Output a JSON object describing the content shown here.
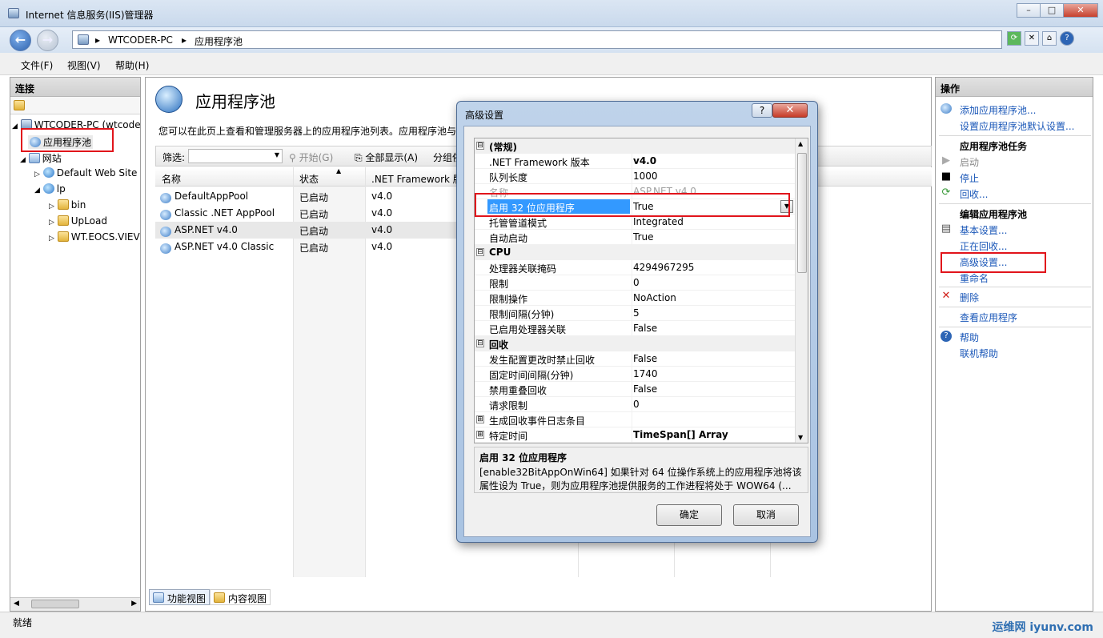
{
  "window": {
    "title": "Internet 信息服务(IIS)管理器",
    "address": [
      "WTCODER-PC",
      "应用程序池"
    ],
    "min": "–",
    "max": "□",
    "close": "✕"
  },
  "menu": [
    "文件(F)",
    "视图(V)",
    "帮助(H)"
  ],
  "left": {
    "header": "连接",
    "tree": [
      {
        "label": "WTCODER-PC (wtcoder",
        "icon": "server-icon"
      },
      {
        "label": "应用程序池",
        "icon": "app-pool-icon"
      },
      {
        "label": "网站",
        "icon": "sites-icon"
      },
      {
        "label": "Default Web Site",
        "icon": "globe-icon"
      },
      {
        "label": "lp",
        "icon": "globe-icon"
      },
      {
        "label": "bin",
        "icon": "folder-icon"
      },
      {
        "label": "UpLoad",
        "icon": "folder-icon"
      },
      {
        "label": "WT.EOCS.VIEV",
        "icon": "folder-icon"
      }
    ]
  },
  "center": {
    "title": "应用程序池",
    "description": "您可以在此页上查看和管理服务器上的应用程序池列表。应用程序池与",
    "filter_label": "筛选:",
    "start_label": "开始(G)",
    "show_all_label": "全部显示(A)",
    "group_label": "分组依",
    "columns": [
      "名称",
      "状态",
      ".NET Framework 版"
    ],
    "rows": [
      {
        "name": "DefaultAppPool",
        "status": "已启动",
        "fw": "v4.0"
      },
      {
        "name": "Classic .NET AppPool",
        "status": "已启动",
        "fw": "v4.0"
      },
      {
        "name": "ASP.NET v4.0",
        "status": "已启动",
        "fw": "v4.0"
      },
      {
        "name": "ASP.NET v4.0 Classic",
        "status": "已启动",
        "fw": "v4.0"
      }
    ],
    "tabs": [
      "功能视图",
      "内容视图"
    ]
  },
  "right": {
    "header": "操作",
    "add_pool": "添加应用程序池...",
    "set_defaults": "设置应用程序池默认设置...",
    "tasks_header": "应用程序池任务",
    "start": "启动",
    "stop": "停止",
    "recycle": "回收...",
    "edit_header": "编辑应用程序池",
    "basic": "基本设置...",
    "recycling": "正在回收...",
    "advanced": "高级设置...",
    "rename": "重命名",
    "delete": "删除",
    "view_apps": "查看应用程序",
    "help": "帮助",
    "online_help": "联机帮助"
  },
  "status": "就绪",
  "dialog": {
    "title": "高级设置",
    "help_btn": "?",
    "close_btn": "✕",
    "props": [
      {
        "cat": true,
        "exp": "⊟",
        "k": "(常规)"
      },
      {
        "k": ".NET Framework 版本",
        "v": "v4.0",
        "bold": true
      },
      {
        "k": "队列长度",
        "v": "1000"
      },
      {
        "k": "名称",
        "v": "ASP.NET v4.0",
        "dim": true
      },
      {
        "k": "启用 32 位应用程序",
        "v": "True",
        "sel": true
      },
      {
        "k": "托管管道模式",
        "v": "Integrated"
      },
      {
        "k": "自动启动",
        "v": "True"
      },
      {
        "cat": true,
        "exp": "⊟",
        "k": "CPU"
      },
      {
        "k": "处理器关联掩码",
        "v": "4294967295"
      },
      {
        "k": "限制",
        "v": "0"
      },
      {
        "k": "限制操作",
        "v": "NoAction"
      },
      {
        "k": "限制间隔(分钟)",
        "v": "5"
      },
      {
        "k": "已启用处理器关联",
        "v": "False"
      },
      {
        "cat": true,
        "exp": "⊟",
        "k": "回收"
      },
      {
        "k": "发生配置更改时禁止回收",
        "v": "False"
      },
      {
        "k": "固定时间间隔(分钟)",
        "v": "1740"
      },
      {
        "k": "禁用重叠回收",
        "v": "False"
      },
      {
        "k": "请求限制",
        "v": "0"
      },
      {
        "k": "生成回收事件日志条目",
        "v": "",
        "exp": "⊞"
      },
      {
        "k": "特定时间",
        "v": "TimeSpan[] Array",
        "exp": "⊞",
        "bold": true
      }
    ],
    "desc_title": "启用 32 位应用程序",
    "desc_line1": "[enable32BitAppOnWin64] 如果针对 64 位操作系统上的应用程序池将该",
    "desc_line2": "属性设为 True，则为应用程序池提供服务的工作进程将处于 WOW64 (...",
    "ok": "确定",
    "cancel": "取消"
  },
  "watermark": "运维网 iyunv.com",
  "colors": {
    "highlight": "#e1141b",
    "selection": "#3399ff",
    "link": "#1a57b8"
  }
}
